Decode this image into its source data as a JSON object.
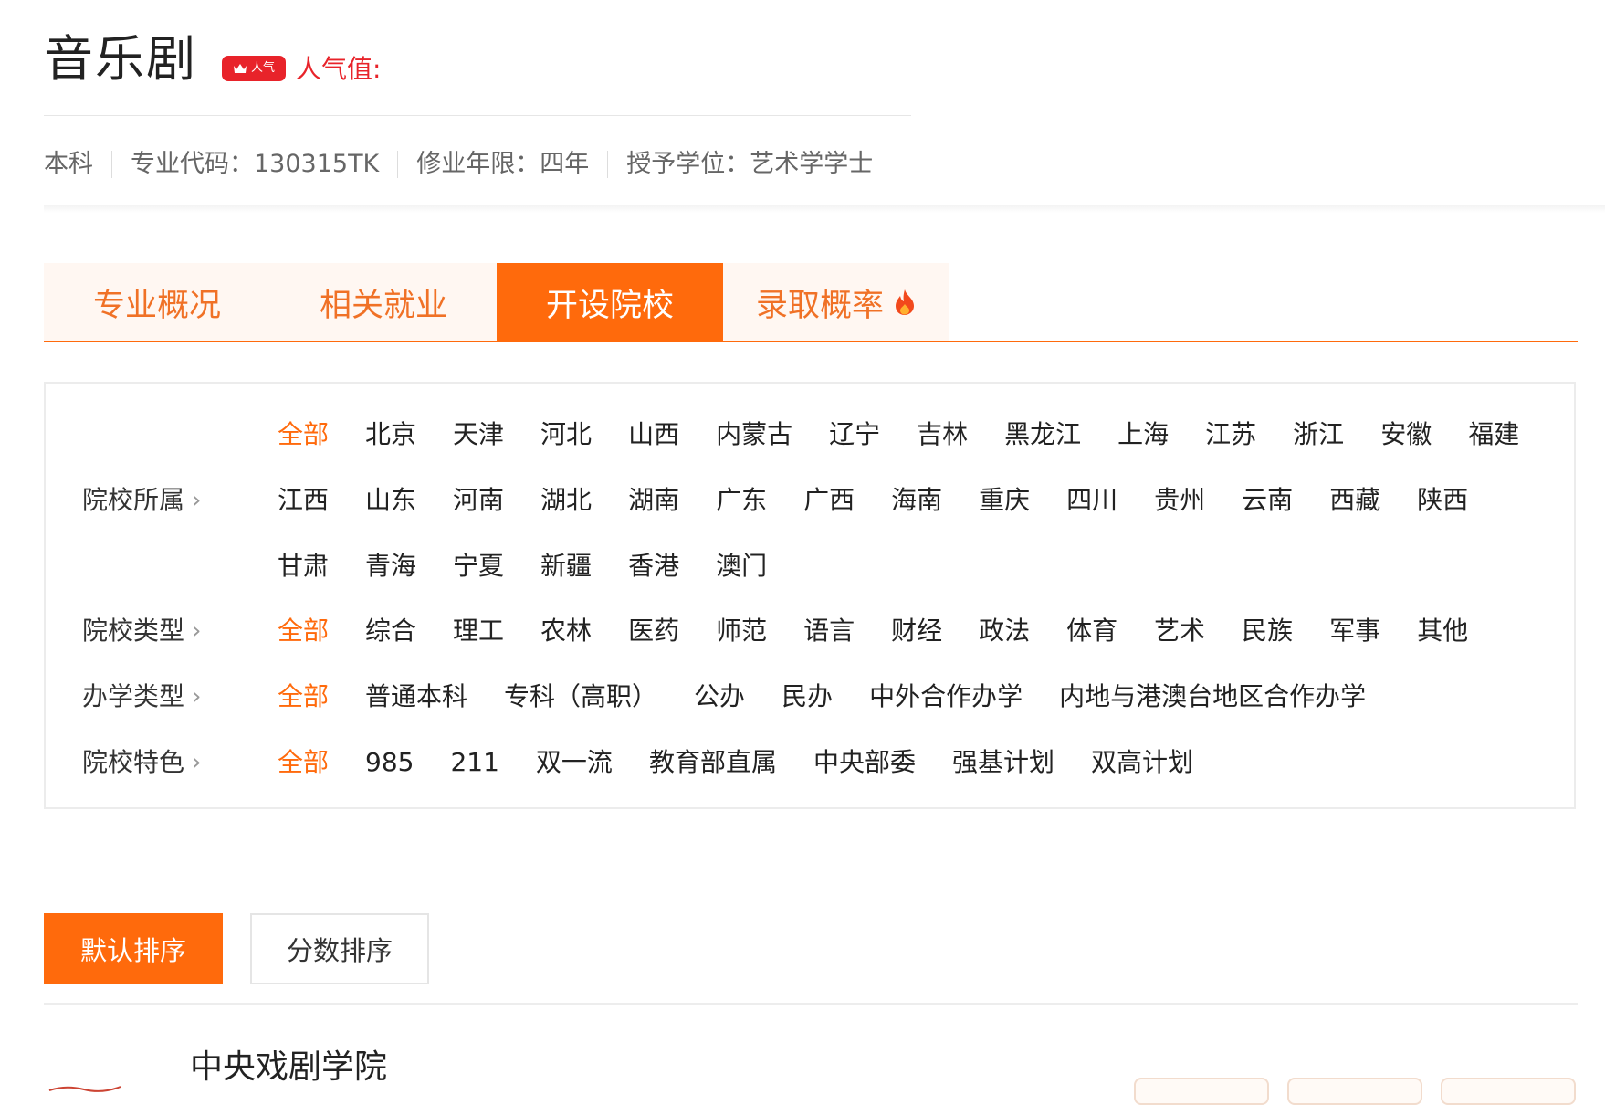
{
  "header": {
    "title": "音乐剧",
    "badge_label": "人气",
    "popularity_label": "人气值:",
    "meta": [
      "本科",
      "专业代码：130315TK",
      "修业年限：四年",
      "授予学位：艺术学学士"
    ]
  },
  "tabs": [
    {
      "label": "专业概况"
    },
    {
      "label": "相关就业"
    },
    {
      "label": "开设院校",
      "active": true
    },
    {
      "label": "录取概率",
      "icon": "flame-icon"
    }
  ],
  "filters": [
    {
      "label": "院校所属",
      "items": [
        "全部",
        "北京",
        "天津",
        "河北",
        "山西",
        "内蒙古",
        "辽宁",
        "吉林",
        "黑龙江",
        "上海",
        "江苏",
        "浙江",
        "安徽",
        "福建",
        "江西",
        "山东",
        "河南",
        "湖北",
        "湖南",
        "广东",
        "广西",
        "海南",
        "重庆",
        "四川",
        "贵州",
        "云南",
        "西藏",
        "陕西",
        "甘肃",
        "青海",
        "宁夏",
        "新疆",
        "香港",
        "澳门"
      ]
    },
    {
      "label": "院校类型",
      "items": [
        "全部",
        "综合",
        "理工",
        "农林",
        "医药",
        "师范",
        "语言",
        "财经",
        "政法",
        "体育",
        "艺术",
        "民族",
        "军事",
        "其他"
      ]
    },
    {
      "label": "办学类型",
      "items": [
        "全部",
        "普通本科",
        "专科（高职）",
        "公办",
        "民办",
        "中外合作办学",
        "内地与港澳台地区合作办学"
      ]
    },
    {
      "label": "院校特色",
      "items": [
        "全部",
        "985",
        "211",
        "双一流",
        "教育部直属",
        "中央部委",
        "强基计划",
        "双高计划"
      ]
    }
  ],
  "sort": {
    "default_label": "默认排序",
    "score_label": "分数排序"
  },
  "schools": [
    {
      "name": "中央戏剧学院"
    }
  ],
  "colors": {
    "accent": "#ff6a0c",
    "hot": "#e8232a"
  }
}
